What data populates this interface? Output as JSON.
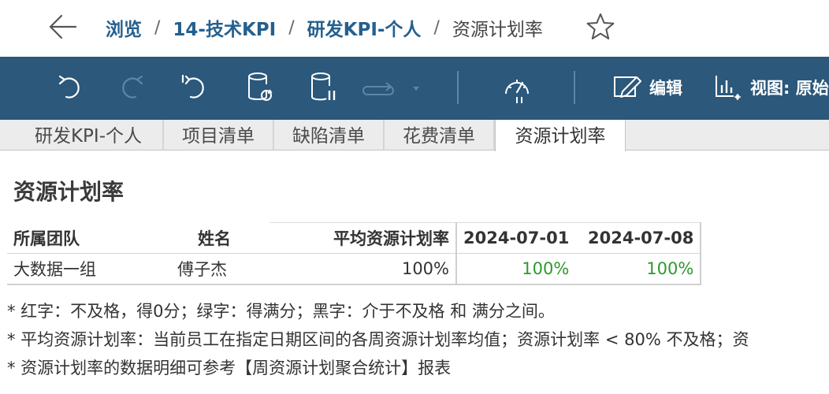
{
  "breadcrumb": {
    "items": [
      "浏览",
      "14-技术KPI",
      "研发KPI-个人"
    ],
    "separator": "/",
    "current": "资源计划率"
  },
  "toolbar": {
    "buttons": [
      {
        "icon": "undo-icon",
        "enabled": true
      },
      {
        "icon": "redo-icon",
        "enabled": false
      },
      {
        "icon": "revert-icon",
        "enabled": true
      },
      {
        "icon": "refresh-data-icon",
        "enabled": true
      },
      {
        "icon": "pause-data-icon",
        "enabled": true
      },
      {
        "icon": "replay-icon",
        "enabled": false
      },
      {
        "icon": "performance-gauge-icon",
        "enabled": true
      }
    ],
    "edit_label": "编辑",
    "view_label": "视图: 原始"
  },
  "tabs": [
    "研发KPI-个人",
    "项目清单",
    "缺陷清单",
    "花费清单",
    "资源计划率"
  ],
  "active_tab": "资源计划率",
  "report": {
    "title": "资源计划率",
    "columns": {
      "team": "所属团队",
      "name": "姓名",
      "avg": "平均资源计划率",
      "d1": "2024-07-01",
      "d2": "2024-07-08"
    },
    "rows": [
      {
        "team": "大数据一组",
        "name": "傅子杰",
        "avg": "100%",
        "d1": "100%",
        "d2": "100%"
      }
    ]
  },
  "notes": [
    "* 红字：不及格，得0分；绿字：得满分；黑字：介于不及格 和 满分之间。",
    "* 平均资源计划率：当前员工在指定日期区间的各周资源计划率均值；资源计划率 < 80% 不及格；资",
    "* 资源计划率的数据明细可参考【周资源计划聚合统计】报表"
  ],
  "colors": {
    "toolbar_bg": "#2b587b",
    "link": "#24608f",
    "good": "#2c9a2c"
  }
}
